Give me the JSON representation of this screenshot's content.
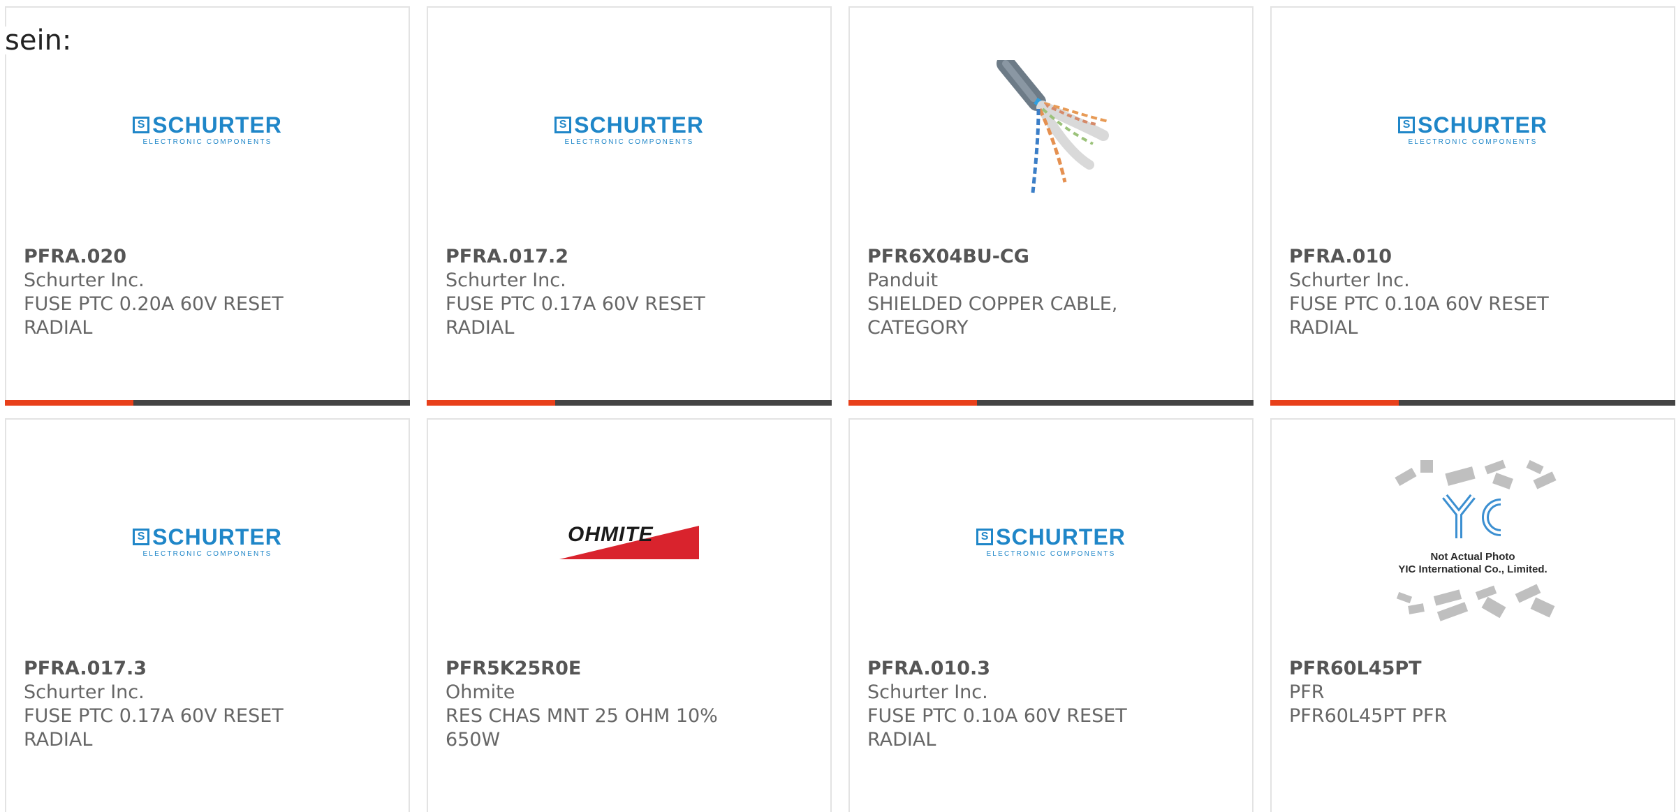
{
  "lead_text": "sein:",
  "colors": {
    "accent_bar": "#e8401a",
    "dark_bar": "#444444",
    "schurter_blue": "#1f86c8",
    "ohmite_red": "#d9232d"
  },
  "logos": {
    "schurter": {
      "mark": "S",
      "word": "SCHURTER",
      "tagline": "ELECTRONIC COMPONENTS"
    },
    "ohmite": {
      "word": "OHMITE"
    },
    "yic": {
      "caption_line1": "Not Actual Photo",
      "caption_line2": "YIC International Co., Limited."
    }
  },
  "products": [
    {
      "part_number": "PFRA.020",
      "manufacturer": "Schurter Inc.",
      "description": "FUSE PTC 0.20A 60V RESET RADIAL",
      "image": "schurter-logo"
    },
    {
      "part_number": "PFRA.017.2",
      "manufacturer": "Schurter Inc.",
      "description": "FUSE PTC 0.17A 60V RESET RADIAL",
      "image": "schurter-logo"
    },
    {
      "part_number": "PFR6X04BU-CG",
      "manufacturer": "Panduit",
      "description": "SHIELDED COPPER CABLE, CATEGORY",
      "image": "cable-photo"
    },
    {
      "part_number": "PFRA.010",
      "manufacturer": "Schurter Inc.",
      "description": "FUSE PTC 0.10A 60V RESET RADIAL",
      "image": "schurter-logo"
    },
    {
      "part_number": "PFRA.017.3",
      "manufacturer": "Schurter Inc.",
      "description": "FUSE PTC 0.17A 60V RESET RADIAL",
      "image": "schurter-logo"
    },
    {
      "part_number": "PFR5K25R0E",
      "manufacturer": "Ohmite",
      "description": "RES CHAS MNT 25 OHM 10% 650W",
      "image": "ohmite-logo"
    },
    {
      "part_number": "PFRA.010.3",
      "manufacturer": "Schurter Inc.",
      "description": "FUSE PTC 0.10A 60V RESET RADIAL",
      "image": "schurter-logo"
    },
    {
      "part_number": "PFR60L45PT",
      "manufacturer": "PFR",
      "description": "PFR60L45PT PFR",
      "image": "yic-placeholder"
    }
  ]
}
